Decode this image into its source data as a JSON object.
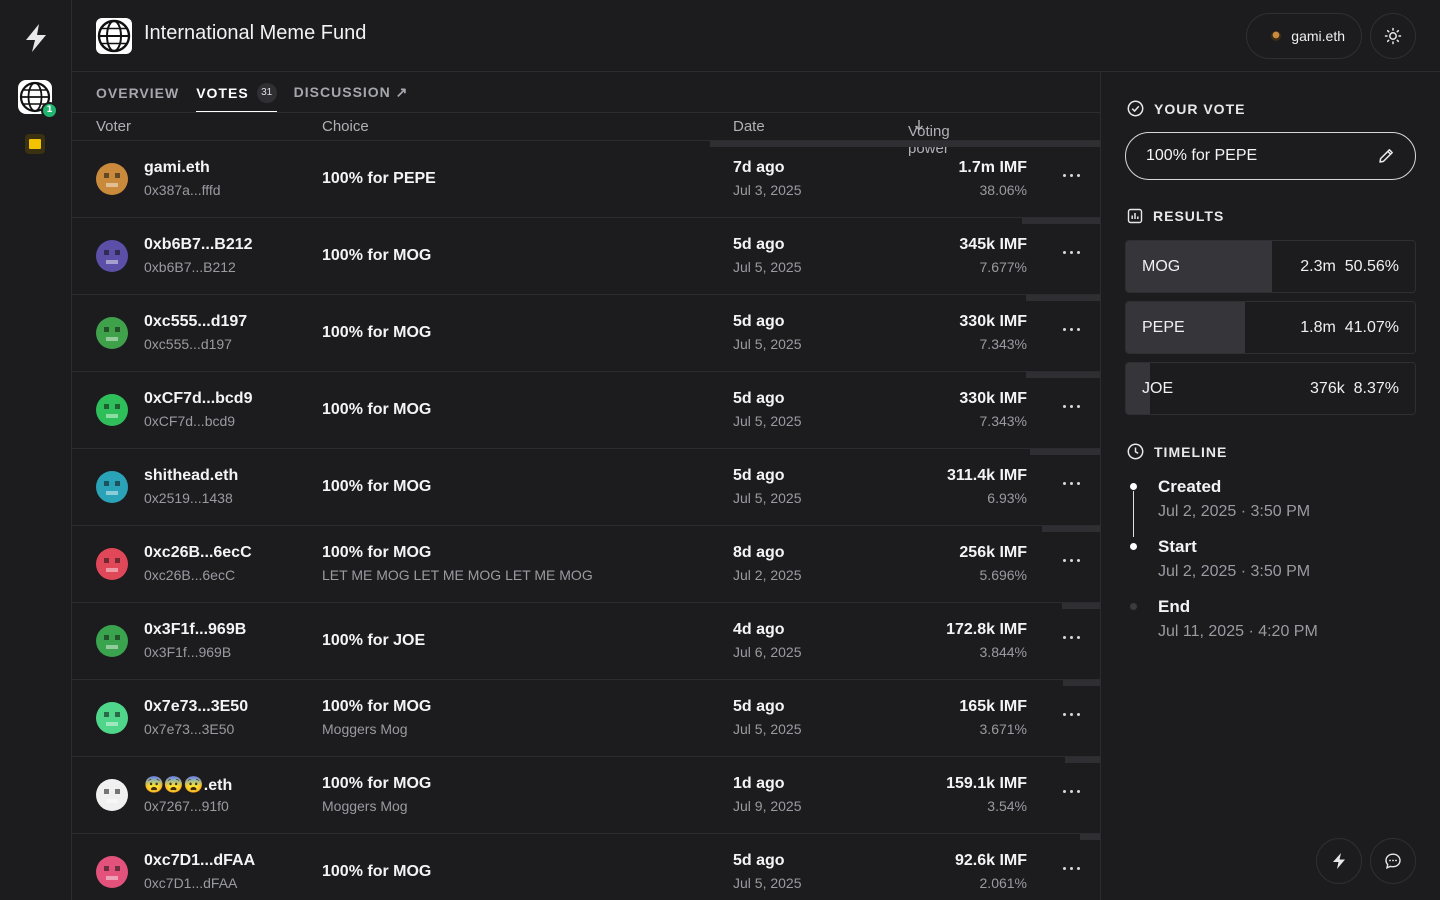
{
  "app": {
    "title": "International Meme Fund",
    "user": "gami.eth",
    "space_badge": "1"
  },
  "tabs": [
    {
      "label": "OVERVIEW"
    },
    {
      "label": "VOTES",
      "count": "31"
    },
    {
      "label": "DISCUSSION ↗"
    }
  ],
  "table": {
    "headers": {
      "voter": "Voter",
      "choice": "Choice",
      "date": "Date",
      "power": "Voting power"
    },
    "rows": [
      {
        "name": "gami.eth",
        "addr": "0x387a...fffd",
        "choice": "100% for PEPE",
        "reason": "",
        "rel": "7d ago",
        "date": "Jul 3, 2025",
        "power": "1.7m IMF",
        "pct": "38.06%",
        "share": 0.3806,
        "avatar_color": "#c98a3c"
      },
      {
        "name": "0xb6B7...B212",
        "addr": "0xb6B7...B212",
        "choice": "100% for MOG",
        "reason": "",
        "rel": "5d ago",
        "date": "Jul 5, 2025",
        "power": "345k IMF",
        "pct": "7.677%",
        "share": 0.07677,
        "avatar_color": "#5b4fa8"
      },
      {
        "name": "0xc555...d197",
        "addr": "0xc555...d197",
        "choice": "100% for MOG",
        "reason": "",
        "rel": "5d ago",
        "date": "Jul 5, 2025",
        "power": "330k IMF",
        "pct": "7.343%",
        "share": 0.07343,
        "avatar_color": "#3fa14a"
      },
      {
        "name": "0xCF7d...bcd9",
        "addr": "0xCF7d...bcd9",
        "choice": "100% for MOG",
        "reason": "",
        "rel": "5d ago",
        "date": "Jul 5, 2025",
        "power": "330k IMF",
        "pct": "7.343%",
        "share": 0.07343,
        "avatar_color": "#2fbf5a"
      },
      {
        "name": "shithead.eth",
        "addr": "0x2519...1438",
        "choice": "100% for MOG",
        "reason": "",
        "rel": "5d ago",
        "date": "Jul 5, 2025",
        "power": "311.4k IMF",
        "pct": "6.93%",
        "share": 0.0693,
        "avatar_color": "#2aa3b8"
      },
      {
        "name": "0xc26B...6ecC",
        "addr": "0xc26B...6ecC",
        "choice": "100% for MOG",
        "reason": "LET ME MOG LET ME MOG LET ME MOG",
        "rel": "8d ago",
        "date": "Jul 2, 2025",
        "power": "256k IMF",
        "pct": "5.696%",
        "share": 0.05696,
        "avatar_color": "#e0485a"
      },
      {
        "name": "0x3F1f...969B",
        "addr": "0x3F1f...969B",
        "choice": "100% for JOE",
        "reason": "",
        "rel": "4d ago",
        "date": "Jul 6, 2025",
        "power": "172.8k IMF",
        "pct": "3.844%",
        "share": 0.03844,
        "avatar_color": "#3aa34d"
      },
      {
        "name": "0x7e73...3E50",
        "addr": "0x7e73...3E50",
        "choice": "100% for MOG",
        "reason": "Moggers Mog",
        "rel": "5d ago",
        "date": "Jul 5, 2025",
        "power": "165k IMF",
        "pct": "3.671%",
        "share": 0.03671,
        "avatar_color": "#4fd68a"
      },
      {
        "name": "😨😨😨.eth",
        "addr": "0x7267...91f0",
        "choice": "100% for MOG",
        "reason": "Moggers Mog",
        "rel": "1d ago",
        "date": "Jul 9, 2025",
        "power": "159.1k IMF",
        "pct": "3.54%",
        "share": 0.0354,
        "avatar_color": "#f0f0f0"
      },
      {
        "name": "0xc7D1...dFAA",
        "addr": "0xc7D1...dFAA",
        "choice": "100% for MOG",
        "reason": "",
        "rel": "5d ago",
        "date": "Jul 5, 2025",
        "power": "92.6k IMF",
        "pct": "2.061%",
        "share": 0.02061,
        "avatar_color": "#e2527a"
      }
    ]
  },
  "your_vote": {
    "title": "YOUR VOTE",
    "value": "100% for PEPE"
  },
  "results": {
    "title": "RESULTS",
    "items": [
      {
        "label": "MOG",
        "value": "2.3m",
        "pct": "50.56%",
        "share": 0.5056
      },
      {
        "label": "PEPE",
        "value": "1.8m",
        "pct": "41.07%",
        "share": 0.4107
      },
      {
        "label": "JOE",
        "value": "376k",
        "pct": "8.37%",
        "share": 0.0837
      }
    ]
  },
  "timeline": {
    "title": "TIMELINE",
    "items": [
      {
        "label": "Created",
        "date": "Jul 2, 2025 · 3:50 PM"
      },
      {
        "label": "Start",
        "date": "Jul 2, 2025 · 3:50 PM"
      },
      {
        "label": "End",
        "date": "Jul 11, 2025 · 4:20 PM"
      }
    ]
  }
}
